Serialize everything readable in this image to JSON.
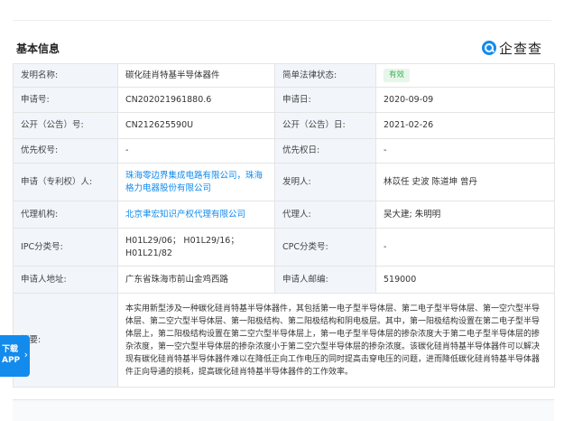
{
  "section_title": "基本信息",
  "brand": "企查查",
  "rows": [
    {
      "l1": "发明名称:",
      "v1": "碳化硅肖特基半导体器件",
      "l2": "简单法律状态:",
      "v2": "有效"
    },
    {
      "l1": "申请号:",
      "v1": "CN202021961880.6",
      "l2": "申请日:",
      "v2": "2020-09-09"
    },
    {
      "l1": "公开（公告）号:",
      "v1": "CN212625590U",
      "l2": "公开（公告）日:",
      "v2": "2021-02-26"
    },
    {
      "l1": "优先权号:",
      "v1": "-",
      "l2": "优先权日:",
      "v2": "-"
    },
    {
      "l1": "申请（专利权）人:",
      "v1": "珠海零边界集成电路有限公司，珠海格力电器股份有限公司",
      "l2": "发明人:",
      "v2": "林苡任 史波 陈道坤 曾丹"
    },
    {
      "l1": "代理机构:",
      "v1": "北京聿宏知识产权代理有限公司",
      "l2": "代理人:",
      "v2": "吴大建; 朱明明"
    },
    {
      "l1": "IPC分类号:",
      "v1": "H01L29/06； H01L29/16； H01L21/82",
      "l2": "CPC分类号:",
      "v2": "-"
    },
    {
      "l1": "申请人地址:",
      "v1": "广东省珠海市前山金鸡西路",
      "l2": "申请人邮编:",
      "v2": "519000"
    }
  ],
  "abstract_label": "摘要:",
  "abstract_text": "本实用新型涉及一种碳化硅肖特基半导体器件，其包括第一电子型半导体层、第二电子型半导体层、第一空穴型半导体层、第二空穴型半导体层、第一阳极结构、第二阳极结构和阴电极层。其中，第一阳极结构设置在第二电子型半导体层上，第二阳极结构设置在第二空穴型半导体层上，第一电子型半导体层的掺杂浓度大于第二电子型半导体层的掺杂浓度，第一空穴型半导体层的掺杂浓度小于第二空穴型半导体层的掺杂浓度。该碳化硅肖特基半导体器件可以解决现有碳化硅肖特基半导体器件难以在降低正向工作电压的同时提高击穿电压的问题，进而降低碳化硅肖特基半导体器件正向导通的损耗，提高碳化硅肖特基半导体器件的工作效率。",
  "app_float": {
    "line1": "下载",
    "line2": "APP",
    "chev": "›"
  },
  "colors": {
    "link": "#128bed",
    "label_bg": "#f2f6fb",
    "status_green": "#3fb254"
  },
  "icons": [
    "qcc-logo-icon",
    "chevron-right-icon"
  ]
}
